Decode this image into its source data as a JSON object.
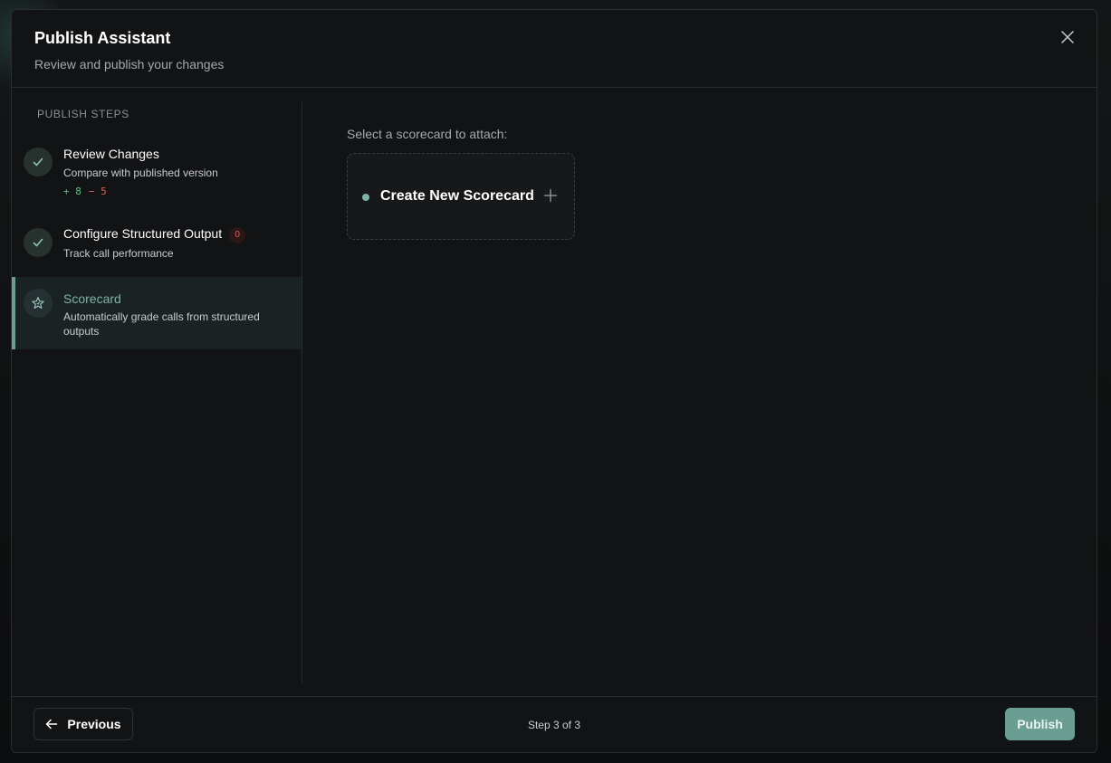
{
  "modal": {
    "title": "Publish Assistant",
    "subtitle": "Review and publish your changes",
    "close_icon": "close-icon"
  },
  "sidebar": {
    "heading": "PUBLISH STEPS",
    "steps": [
      {
        "title": "Review Changes",
        "description": "Compare with published version",
        "additions": "+ 8",
        "removals": "− 5",
        "status": "complete",
        "icon": "check-icon"
      },
      {
        "title": "Configure Structured Output",
        "description": "Track call performance",
        "badge": "0",
        "status": "complete",
        "icon": "check-icon"
      },
      {
        "title": "Scorecard",
        "description": "Automatically grade calls from structured outputs",
        "status": "active",
        "icon": "star-icon"
      }
    ]
  },
  "main": {
    "select_label": "Select a scorecard to attach:",
    "create_card_label": "Create New Scorecard",
    "create_card_icon": "plus-icon"
  },
  "footer": {
    "previous_label": "Previous",
    "previous_icon": "arrow-left-icon",
    "step_counter": "Step 3 of 3",
    "publish_label": "Publish"
  },
  "colors": {
    "accent": "#6b9e92",
    "active_text": "#7fb3a6",
    "addition": "#5fbf7f",
    "removal": "#e0605a",
    "background": "#121315"
  }
}
